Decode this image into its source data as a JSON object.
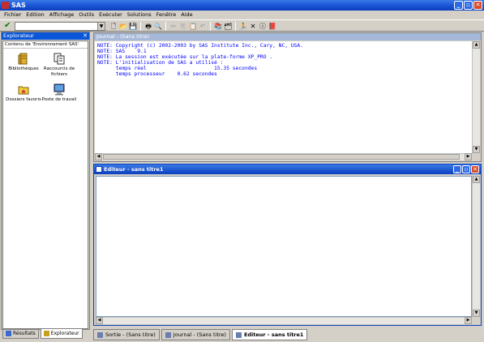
{
  "window": {
    "title": "SAS"
  },
  "menu": [
    "Fichier",
    "Edition",
    "Affichage",
    "Outils",
    "Exécuter",
    "Solutions",
    "Fenêtre",
    "Aide"
  ],
  "explorer": {
    "title": "Explorateur",
    "heading": "Contenu de 'Environnement SAS'",
    "items": [
      {
        "label": "Bibliothèques",
        "icon": "library-icon"
      },
      {
        "label": "Raccourcis de fichiers",
        "icon": "file-shortcuts-icon"
      },
      {
        "label": "Dossiers favoris",
        "icon": "favorite-folders-icon"
      },
      {
        "label": "Poste de travail",
        "icon": "my-computer-icon"
      }
    ],
    "tabs": [
      {
        "label": "Résultats"
      },
      {
        "label": "Explorateur"
      }
    ]
  },
  "journal": {
    "title": "Journal - (Sans titre)",
    "lines": [
      "NOTE: Copyright (c) 2002-2003 by SAS Institute Inc., Cary, NC, USA.",
      "NOTE: SAS    9.1",
      "",
      "NOTE: La session est exécutée sur la plate-forme XP_PRO .",
      "",
      "",
      "NOTE: L'initialisation de SAS a utilisé :",
      "      temps réel                      15.35 secondes",
      "      temps processeur    0.62 secondes"
    ]
  },
  "editor": {
    "title": "Editeur - sans titre1"
  },
  "taskbar": [
    {
      "label": "Sortie - (Sans titre)"
    },
    {
      "label": "Journal - (Sans titre)"
    },
    {
      "label": "Editeur - sans titre1"
    }
  ],
  "colors": {
    "title_blue": "#0a3fbf",
    "log_text": "#0000ff",
    "bg": "#d4d0c8"
  }
}
